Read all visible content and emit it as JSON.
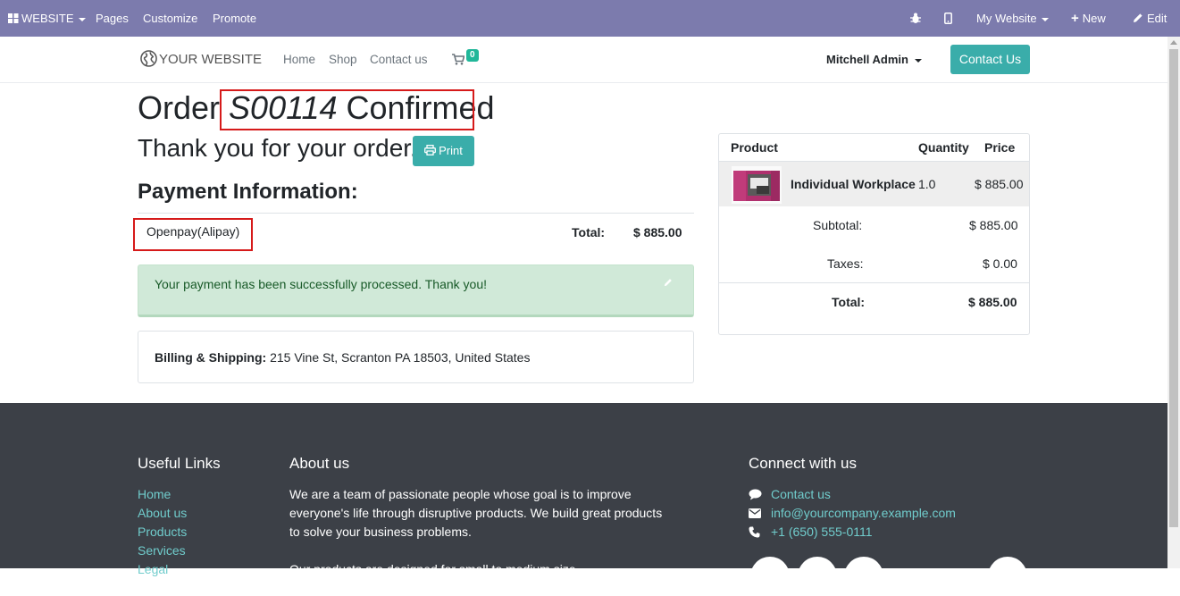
{
  "adminbar": {
    "apps_label": "WEBSITE",
    "menu": [
      "Pages",
      "Customize",
      "Promote"
    ],
    "site_selector": "My Website",
    "new_label": "New",
    "edit_label": "Edit"
  },
  "nav": {
    "logo_text": "YOUR WEBSITE",
    "links": [
      "Home",
      "Shop",
      "Contact us"
    ],
    "cart_count": "0",
    "user": "Mitchell Admin",
    "cta": "Contact Us"
  },
  "order": {
    "title_prefix": "Order",
    "number": "S00114",
    "title_suffix": "Confirmed",
    "thanks": "Thank you for your order.",
    "print_label": "Print",
    "payment_heading": "Payment Information:",
    "payment_method": "Openpay(Alipay)",
    "total_label": "Total:",
    "total_value": "$ 885.00",
    "alert_message": "Your payment has been successfully processed. Thank you!",
    "billing_label": "Billing & Shipping:",
    "billing_address": "215 Vine St, Scranton PA 18503, United States"
  },
  "summary": {
    "headers": {
      "product": "Product",
      "quantity": "Quantity",
      "price": "Price"
    },
    "item": {
      "name": "Individual Workplace",
      "qty": "1.0",
      "price": "$ 885.00"
    },
    "subtotal_label": "Subtotal:",
    "subtotal_value": "$ 885.00",
    "taxes_label": "Taxes:",
    "taxes_value": "$ 0.00",
    "total_label": "Total:",
    "total_value": "$ 885.00"
  },
  "footer": {
    "useful_links_title": "Useful Links",
    "useful_links": [
      "Home",
      "About us",
      "Products",
      "Services",
      "Legal"
    ],
    "about_title": "About us",
    "about_text": "We are a team of passionate people whose goal is to improve everyone's life through disruptive products. We build great products to solve your business problems.",
    "about_text2": "Our products are designed for small to medium size",
    "connect_title": "Connect with us",
    "contact_link": "Contact us",
    "email": "info@yourcompany.example.com",
    "phone": "+1 (650) 555-0111"
  },
  "colors": {
    "adminbar": "#7c7bad",
    "accent": "#3aadaa",
    "alert_bg": "#d0e9d8",
    "footer_bg": "#3c4047",
    "highlight_box": "#d61a1a"
  }
}
